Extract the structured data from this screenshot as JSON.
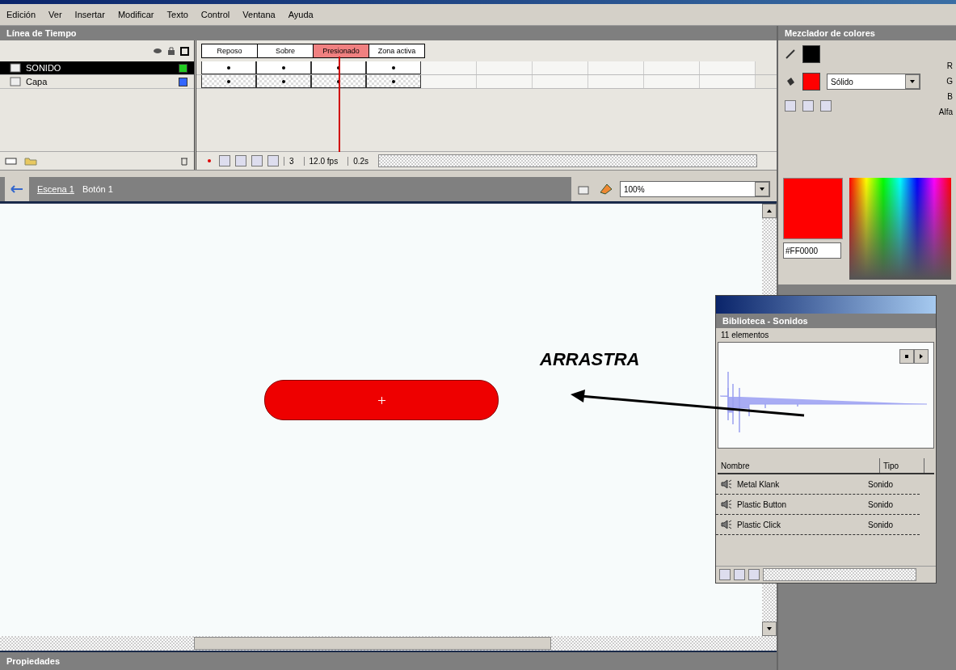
{
  "menu": [
    "Edición",
    "Ver",
    "Insertar",
    "Modificar",
    "Texto",
    "Control",
    "Ventana",
    "Ayuda"
  ],
  "timeline": {
    "title": "Línea de Tiempo",
    "frame_labels": [
      {
        "label": "Reposo",
        "selected": false
      },
      {
        "label": "Sobre",
        "selected": false
      },
      {
        "label": "Presionado",
        "selected": true
      },
      {
        "label": "Zona activa",
        "selected": false
      }
    ],
    "layers": [
      {
        "name": "SONIDO",
        "selected": true,
        "color": "#22cc22"
      },
      {
        "name": "Capa",
        "selected": false,
        "color": "#3366ff"
      }
    ],
    "current_frame": "3",
    "frame_rate": "12.0 fps",
    "elapsed": "0.2s"
  },
  "scene": {
    "items": [
      "Escena 1",
      "Botón 1"
    ],
    "zoom": "100%"
  },
  "annotation": "ARRASTRA",
  "color_mixer": {
    "title": "Mezclador de colores",
    "fill_type": "Sólido",
    "hex": "#FF0000",
    "channels": [
      "R",
      "G",
      "B",
      "Alfa"
    ]
  },
  "library": {
    "title": "Biblioteca - Sonidos",
    "count": "11 elementos",
    "columns": [
      "Nombre",
      "Tipo"
    ],
    "items": [
      {
        "name": "Metal Klank",
        "type": "Sonido"
      },
      {
        "name": "Plastic Button",
        "type": "Sonido"
      },
      {
        "name": "Plastic Click",
        "type": "Sonido"
      }
    ]
  },
  "properties": {
    "title": "Propiedades"
  }
}
